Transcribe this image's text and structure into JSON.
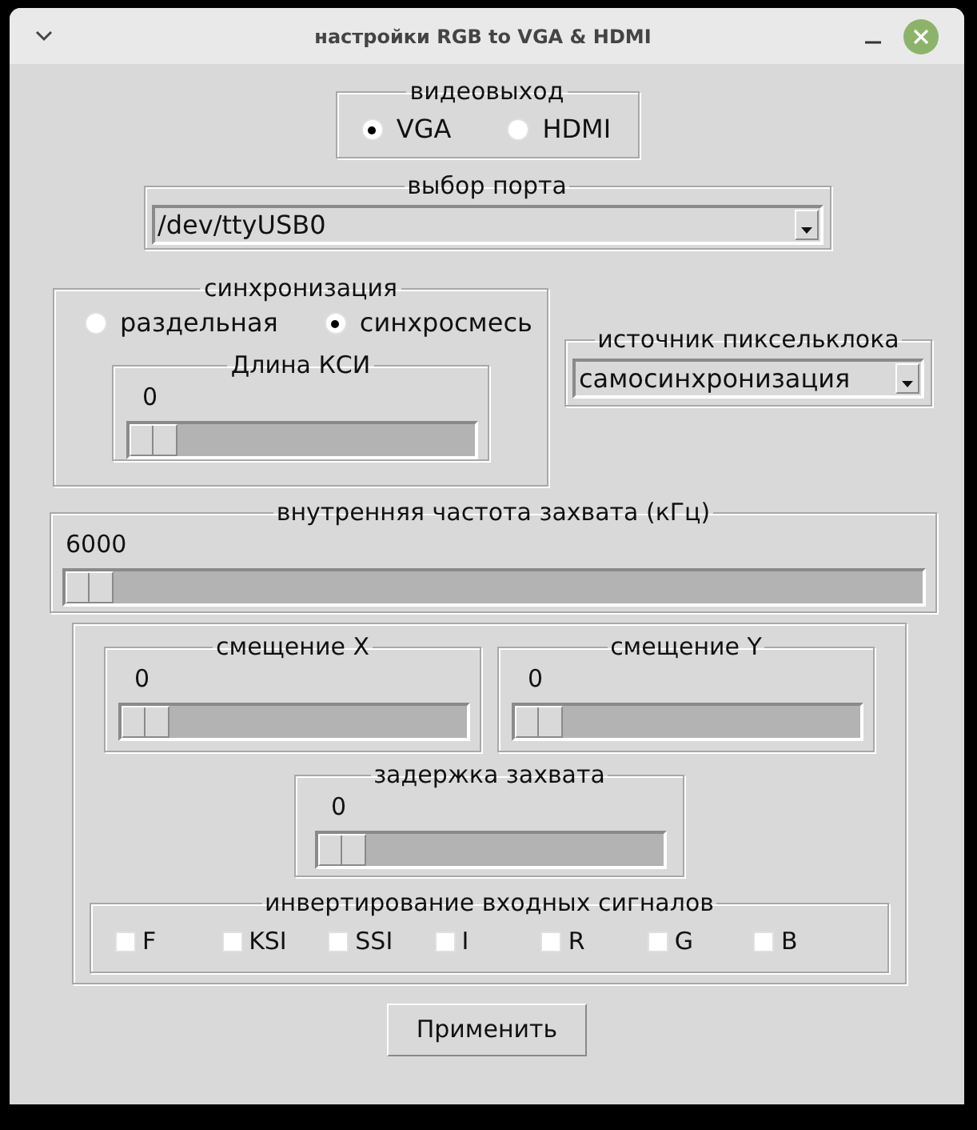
{
  "window": {
    "title": "настройки RGB to VGA & HDMI"
  },
  "video_output": {
    "label": "видеовыход",
    "options": [
      {
        "label": "VGA",
        "selected": true
      },
      {
        "label": "HDMI",
        "selected": false
      }
    ]
  },
  "port": {
    "label": "выбор порта",
    "value": "/dev/ttyUSB0"
  },
  "sync": {
    "label": "синхронизация",
    "options": [
      {
        "label": "раздельная",
        "selected": false
      },
      {
        "label": "синхросмесь",
        "selected": true
      }
    ],
    "ksi_length": {
      "label": "Длина КСИ",
      "reading": "0",
      "level": 0
    }
  },
  "pixel_clock": {
    "label": "источник пиксельклока",
    "value": "самосинхронизация"
  },
  "capture_frequency": {
    "label": "внутренняя частота захвата (кГц)",
    "reading": "6000",
    "level": 0
  },
  "offset_x": {
    "label": "смещение X",
    "reading": "0",
    "level": 0
  },
  "offset_y": {
    "label": "смещение Y",
    "reading": "0",
    "level": 0
  },
  "capture_delay": {
    "label": "задержка захвата",
    "reading": "0",
    "level": 0
  },
  "input_inversion": {
    "label": "инвертирование входных сигналов",
    "signals": [
      {
        "label": "F",
        "checked": false
      },
      {
        "label": "KSI",
        "checked": false
      },
      {
        "label": "SSI",
        "checked": false
      },
      {
        "label": "I",
        "checked": false
      },
      {
        "label": "R",
        "checked": false
      },
      {
        "label": "G",
        "checked": false
      },
      {
        "label": "B",
        "checked": false
      }
    ]
  },
  "apply_button": "Применить"
}
